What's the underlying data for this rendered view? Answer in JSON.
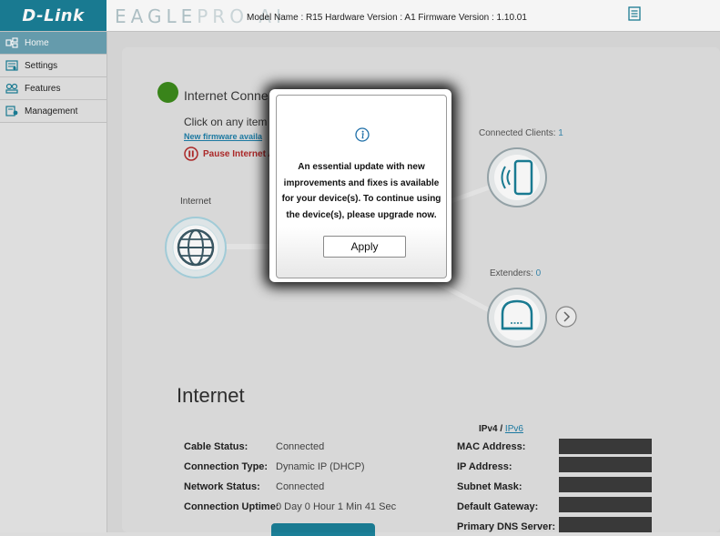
{
  "header": {
    "logo": "D-Link",
    "brand_strong": "EAGLE",
    "brand_light": "PRO AI",
    "model_info": "Model Name : R15 Hardware Version : A1 Firmware Version : 1.10.01"
  },
  "sidebar": {
    "items": [
      {
        "label": "Home",
        "icon": "home-icon",
        "active": true
      },
      {
        "label": "Settings",
        "icon": "settings-icon",
        "active": false
      },
      {
        "label": "Features",
        "icon": "features-icon",
        "active": false
      },
      {
        "label": "Management",
        "icon": "management-icon",
        "active": false
      }
    ]
  },
  "status": {
    "title": "Internet Conne",
    "click_text": "Click on any item i",
    "firmware_link": "New firmware availa",
    "pause_label": "Pause Internet A",
    "internet_label": "Internet",
    "clients_label": "Connected Clients:",
    "clients_count": "1",
    "extenders_label": "Extenders:",
    "extenders_count": "0"
  },
  "internet_section": {
    "title": "Internet",
    "ipv4": "IPv4",
    "separator": "/",
    "ipv6": "IPv6",
    "left_rows": [
      {
        "label": "Cable Status:",
        "value": "Connected"
      },
      {
        "label": "Connection Type:",
        "value": "Dynamic IP (DHCP)"
      },
      {
        "label": "Network Status:",
        "value": "Connected"
      },
      {
        "label": "Connection Uptime:",
        "value": "0 Day 0 Hour 1 Min 41 Sec"
      }
    ],
    "right_rows": [
      {
        "label": "MAC Address:"
      },
      {
        "label": "IP Address:"
      },
      {
        "label": "Subnet Mask:"
      },
      {
        "label": "Default Gateway:"
      },
      {
        "label": "Primary DNS Server:"
      }
    ]
  },
  "modal": {
    "icon": "info-icon",
    "message": "An essential update with new improvements and fixes is available for your device(s). To continue using the device(s), please upgrade now.",
    "apply_label": "Apply"
  },
  "colors": {
    "brand": "#1b7f97",
    "sidebar_active": "#6aa2b3",
    "status_ok": "#3c8a1c",
    "pause_red": "#b22a2a",
    "link": "#1e7ea8",
    "node_ring": "#8ec6d6"
  }
}
